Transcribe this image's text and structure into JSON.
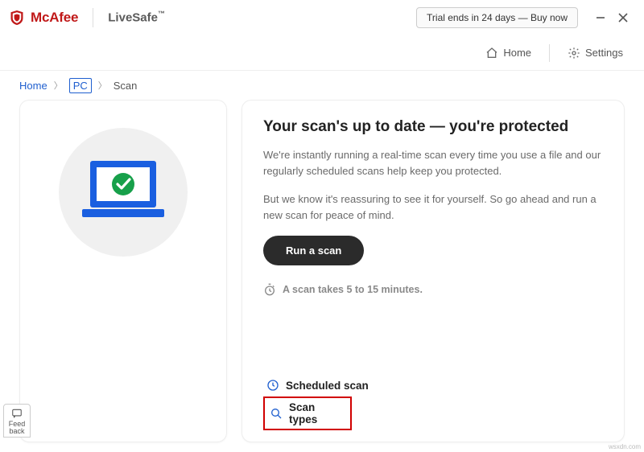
{
  "titlebar": {
    "brand": "McAfee",
    "product": "LiveSafe",
    "tm": "™",
    "trial": "Trial ends in 24 days — Buy now"
  },
  "nav": {
    "home": "Home",
    "settings": "Settings"
  },
  "breadcrumbs": {
    "home": "Home",
    "pc": "PC",
    "scan": "Scan"
  },
  "main": {
    "heading": "Your scan's up to date — you're protected",
    "p1": "We're instantly running a real-time scan every time you use a file and our regularly scheduled scans help keep you protected.",
    "p2": "But we know it's reassuring to see it for yourself. So go ahead and run a new scan for peace of mind.",
    "run_button": "Run a scan",
    "timer": "A scan takes 5 to 15 minutes."
  },
  "links": {
    "scheduled": "Scheduled scan",
    "types": "Scan types"
  },
  "feedback": {
    "l1": "Feed",
    "l2": "back"
  },
  "watermark": "wsxdn.com"
}
